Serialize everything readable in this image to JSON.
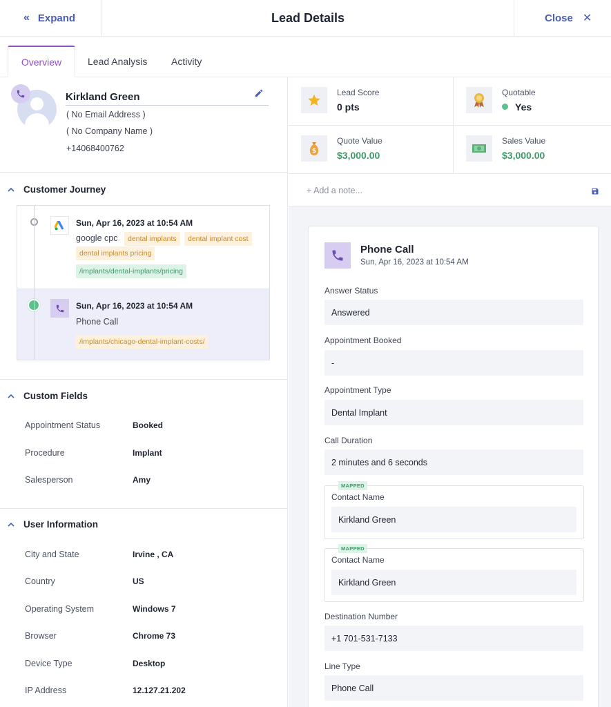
{
  "header": {
    "expand_label": "Expand",
    "title": "Lead Details",
    "close_label": "Close"
  },
  "tabs": [
    {
      "label": "Overview"
    },
    {
      "label": "Lead Analysis"
    },
    {
      "label": "Activity"
    }
  ],
  "profile": {
    "name": "Kirkland Green",
    "email": "( No Email Address )",
    "company": "( No Company Name )",
    "phone": "+14068400762"
  },
  "customer_journey": {
    "title": "Customer Journey",
    "items": [
      {
        "date": "Sun, Apr 16, 2023 at 10:54 AM",
        "source": "google cpc",
        "keywords": [
          "dental implants",
          "dental implant cost",
          "dental implants pricing"
        ],
        "url": "/implants/dental-implants/pricing"
      },
      {
        "date": "Sun, Apr 16, 2023 at 10:54 AM",
        "source": "Phone Call",
        "url": "/implants/chicago-dental-implant-costs/"
      }
    ]
  },
  "custom_fields": {
    "title": "Custom Fields",
    "rows": [
      {
        "label": "Appointment Status",
        "value": "Booked"
      },
      {
        "label": "Procedure",
        "value": "Implant"
      },
      {
        "label": "Salesperson",
        "value": "Amy"
      }
    ]
  },
  "user_information": {
    "title": "User Information",
    "rows": [
      {
        "label": "City and State",
        "value": "Irvine , CA"
      },
      {
        "label": "Country",
        "value": "US"
      },
      {
        "label": "Operating System",
        "value": "Windows 7"
      },
      {
        "label": "Browser",
        "value": "Chrome 73"
      },
      {
        "label": "Device Type",
        "value": "Desktop"
      },
      {
        "label": "IP Address",
        "value": "12.127.21.202"
      }
    ]
  },
  "stats": {
    "lead_score": {
      "label": "Lead Score",
      "value": "0 pts"
    },
    "quotable": {
      "label": "Quotable",
      "value": "Yes"
    },
    "quote_value": {
      "label": "Quote Value",
      "value": "$3,000.00"
    },
    "sales_value": {
      "label": "Sales Value",
      "value": "$3,000.00"
    }
  },
  "note": {
    "placeholder": "+ Add a note..."
  },
  "phone_call": {
    "title": "Phone Call",
    "date": "Sun, Apr 16, 2023 at 10:54 AM",
    "fields": {
      "answer_status": {
        "label": "Answer Status",
        "value": "Answered"
      },
      "appointment_booked": {
        "label": "Appointment Booked",
        "value": "-"
      },
      "appointment_type": {
        "label": "Appointment Type",
        "value": "Dental Implant"
      },
      "call_duration": {
        "label": "Call Duration",
        "value": "2 minutes and 6 seconds"
      },
      "contact_name_1": {
        "tag": "MAPPED",
        "label": "Contact Name",
        "value": "Kirkland Green"
      },
      "contact_name_2": {
        "tag": "MAPPED",
        "label": "Contact Name",
        "value": "Kirkland Green"
      },
      "destination_number": {
        "label": "Destination Number",
        "value": "+1 701-531-7133"
      },
      "line_type": {
        "label": "Line Type",
        "value": "Phone Call"
      }
    }
  },
  "colors": {
    "accent": "#8e52c8",
    "link": "#4a5fb5",
    "green": "#3e9a68",
    "phone_bg": "#d7cdf1"
  }
}
